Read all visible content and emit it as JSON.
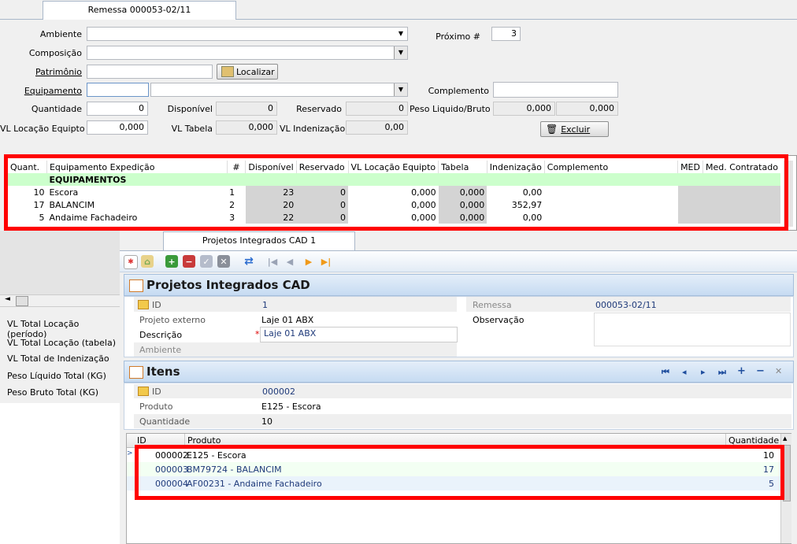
{
  "top_tab": "Remessa 000053-02/11",
  "form": {
    "ambiente_label": "Ambiente",
    "composicao_label": "Composição",
    "patrimonio_label": "Patrimônio",
    "localizar_label": "Localizar",
    "equipamento_label": "Equipamento",
    "quantidade_label": "Quantidade",
    "quantidade_value": "0",
    "disponivel_label": "Disponível",
    "disponivel_value": "0",
    "reservado_label": "Reservado",
    "reservado_value": "0",
    "peso_label": "Peso Liquido/Bruto",
    "peso_liquido_value": "0,000",
    "peso_bruto_value": "0,000",
    "vl_locacao_label": "VL Locação Equipto",
    "vl_locacao_value": "0,000",
    "vl_tabela_label": "VL Tabela",
    "vl_tabela_value": "0,000",
    "vl_indenizacao_label": "VL Indenização",
    "vl_indenizacao_value": "0,00",
    "proximo_label": "Próximo #",
    "proximo_value": "3",
    "complemento_label": "Complemento",
    "excluir_label": "Excluir"
  },
  "equip_grid": {
    "headers": [
      "Quant.",
      "Equipamento Expedição",
      "#",
      "Disponível",
      "Reservado",
      "VL Locação Equipto",
      "Tabela",
      "Indenização",
      "Complemento",
      "MED",
      "Med. Contratado"
    ],
    "group_label": "EQUIPAMENTOS",
    "rows": [
      {
        "quant": "10",
        "equip": "Escora",
        "num": "1",
        "disp": "23",
        "res": "0",
        "vl": "0,000",
        "tab": "0,000",
        "ind": "0,00"
      },
      {
        "quant": "17",
        "equip": "BALANCIM",
        "num": "2",
        "disp": "20",
        "res": "0",
        "vl": "0,000",
        "tab": "0,000",
        "ind": "352,97"
      },
      {
        "quant": "5",
        "equip": "Andaime Fachadeiro",
        "num": "3",
        "disp": "22",
        "res": "0",
        "vl": "0,000",
        "tab": "0,000",
        "ind": "0,00"
      }
    ]
  },
  "totals": {
    "items": [
      "VL Total Locação (período)",
      "VL Total Locação (tabela)",
      "VL Total de Indenização",
      "Peso Líquido Total (KG)",
      "Peso Bruto Total (KG)"
    ]
  },
  "cad": {
    "tab": "Projetos Integrados CAD 1",
    "section_title": "Projetos Integrados CAD",
    "id_label": "ID",
    "id_value": "1",
    "projeto_externo_label": "Projeto externo",
    "projeto_externo_value": "Laje 01 ABX",
    "descricao_label": "Descrição",
    "descricao_value": "Laje 01 ABX",
    "ambiente_label": "Ambiente",
    "remessa_label": "Remessa",
    "remessa_value": "000053-02/11",
    "observacao_label": "Observação",
    "required_mark": "*"
  },
  "itens": {
    "title": "Itens",
    "id_label": "ID",
    "id_value": "000002",
    "produto_label": "Produto",
    "produto_value": "E125 - Escora",
    "quantidade_label": "Quantidade",
    "quantidade_value": "10",
    "grid_headers": [
      "ID",
      "Produto",
      "Quantidade"
    ],
    "rows": [
      {
        "id": "000002",
        "produto": "E125 - Escora",
        "qtd": "10"
      },
      {
        "id": "000003",
        "produto": "BM79724 - BALANCIM",
        "qtd": "17"
      },
      {
        "id": "000004",
        "produto": "AF00231 - Andaime Fachadeiro",
        "qtd": "5"
      }
    ]
  },
  "colors": {
    "highlight": "#ff0000",
    "group_row": "#ccffcc",
    "selected_blue": "#1f3a7a"
  }
}
